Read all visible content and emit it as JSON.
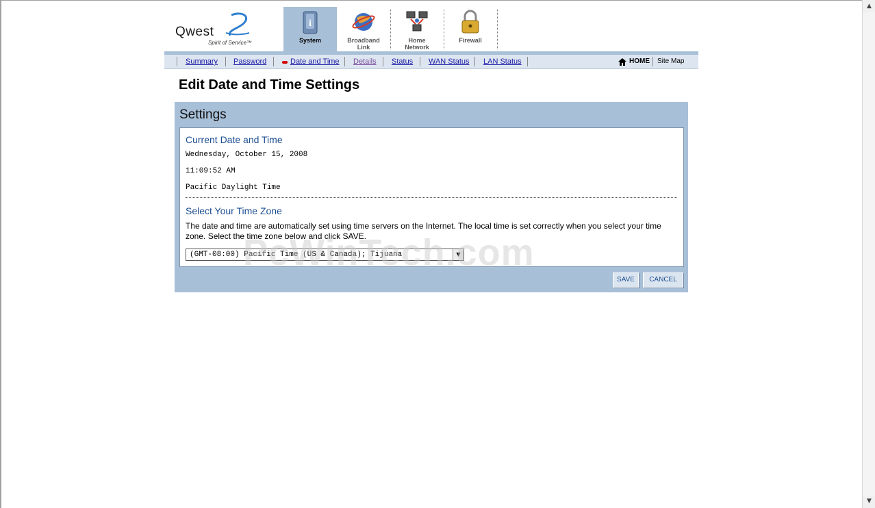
{
  "logo": {
    "word": "Qwest",
    "tagline": "Spirit of Service™"
  },
  "tabs": [
    {
      "label": "System",
      "icon": "system-info-icon",
      "active": true
    },
    {
      "label": "Broadband Link",
      "icon": "globe-icon",
      "active": false
    },
    {
      "label": "Home Network",
      "icon": "network-computers-icon",
      "active": false
    },
    {
      "label": "Firewall",
      "icon": "padlock-icon",
      "active": false
    }
  ],
  "subnav": {
    "items": [
      "Summary",
      "Password",
      "Date and Time",
      "Details",
      "Status",
      "WAN Status",
      "LAN Status"
    ],
    "current": "Date and Time",
    "home": "HOME",
    "sitemap": "Site Map"
  },
  "page": {
    "title": "Edit Date and Time Settings"
  },
  "settings": {
    "title": "Settings",
    "current_title": "Current Date and Time",
    "date": "Wednesday, October 15, 2008",
    "time": "11:09:52 AM",
    "zone_name": "Pacific Daylight Time",
    "tz_title": "Select Your Time Zone",
    "description": "The date and time are automatically set using time servers on the Internet. The local time is set correctly when you select your time zone. Select the time zone below and click SAVE.",
    "selected_zone": "(GMT-08:00) Pacific Time (US & Canada); Tijuana",
    "save_label": "SAVE",
    "cancel_label": "CANCEL"
  },
  "watermark": "PcWinTech.com",
  "colors": {
    "accent_blue": "#a8bfd8",
    "link": "#1a1aa6",
    "heading": "#1d4f91",
    "marker": "#d40000"
  }
}
